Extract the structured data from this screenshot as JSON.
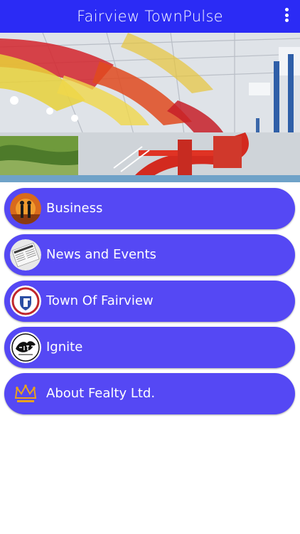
{
  "app": {
    "title": "Fairview TownPulse",
    "icons": {
      "menu": "more-vertical-icon"
    },
    "colors": {
      "appbar": "#2b2bf5",
      "button": "#5548f4",
      "text": "#ffffff"
    }
  },
  "carousel": {
    "slide_count": 1,
    "active_index": 0
  },
  "menu": {
    "items": [
      {
        "label": "Business",
        "icon": "business-people-icon"
      },
      {
        "label": "News and Events",
        "icon": "newspaper-icon"
      },
      {
        "label": "Town Of Fairview",
        "icon": "town-crest-icon"
      },
      {
        "label": "Ignite",
        "icon": "ignite-logo-icon"
      },
      {
        "label": "About Fealty Ltd.",
        "icon": "fealty-crown-icon"
      }
    ]
  }
}
